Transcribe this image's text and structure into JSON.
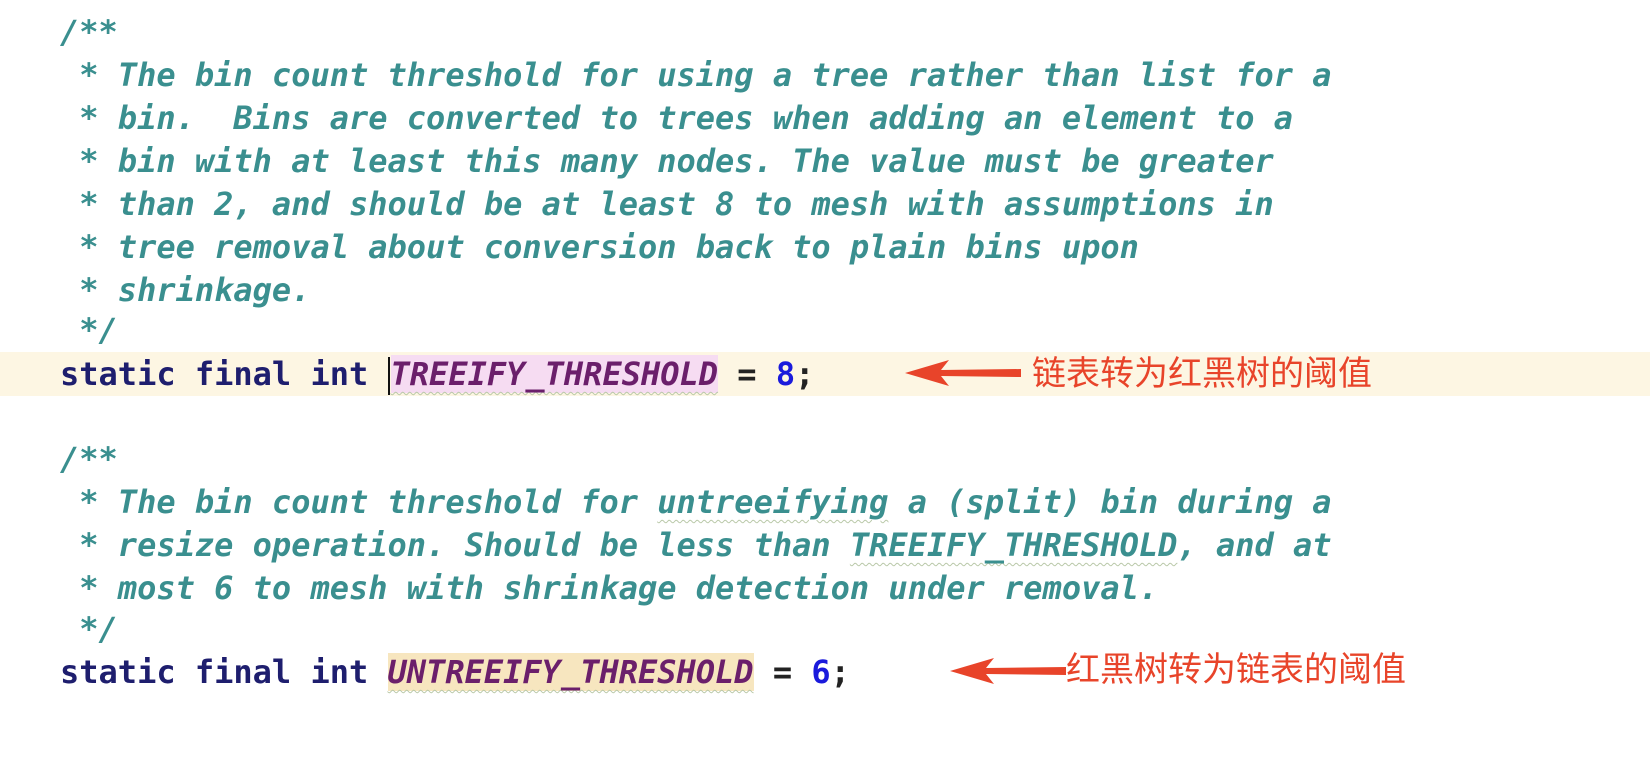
{
  "editor": {
    "block1": {
      "comment_open": "/**",
      "comment_lines": [
        " * The bin count threshold for using a tree rather than list for a",
        " * bin.  Bins are converted to trees when adding an element to a",
        " * bin with at least this many nodes. The value must be greater",
        " * than 2, and should be at least 8 to mesh with assumptions in",
        " * tree removal about conversion back to plain bins upon",
        " * shrinkage."
      ],
      "comment_close": " */",
      "keywords": "static final int ",
      "constant": "TREEIFY_THRESHOLD",
      "assign": " = ",
      "value": "8",
      "semicolon": ";"
    },
    "block2": {
      "comment_open": "/**",
      "line1_prefix": " * The bin count threshold for ",
      "line1_underlined": "untreeifying",
      "line1_suffix": " a (split) bin during a",
      "line2_prefix": " * resize operation. Should be less than ",
      "line2_underlined": "TREEIFY_THRESHOLD",
      "line2_suffix": ", and at",
      "line3": " * most 6 to mesh with shrinkage detection under removal.",
      "comment_close": " */",
      "keywords": "static final int ",
      "constant": "UNTREEIFY_THRESHOLD",
      "assign": " = ",
      "value": "6",
      "semicolon": ";"
    }
  },
  "annotations": {
    "treeify": "链表转为红黑树的阈值",
    "untreeify": "红黑树转为链表的阈值"
  },
  "colors": {
    "comment": "#3a8f8f",
    "keyword": "#1e1e6e",
    "constant": "#6b1f6b",
    "number": "#1a1adc",
    "annotation": "#e8442a",
    "current_line": "#fdf6e3"
  },
  "icons": {
    "arrow": "left-arrow-icon"
  }
}
